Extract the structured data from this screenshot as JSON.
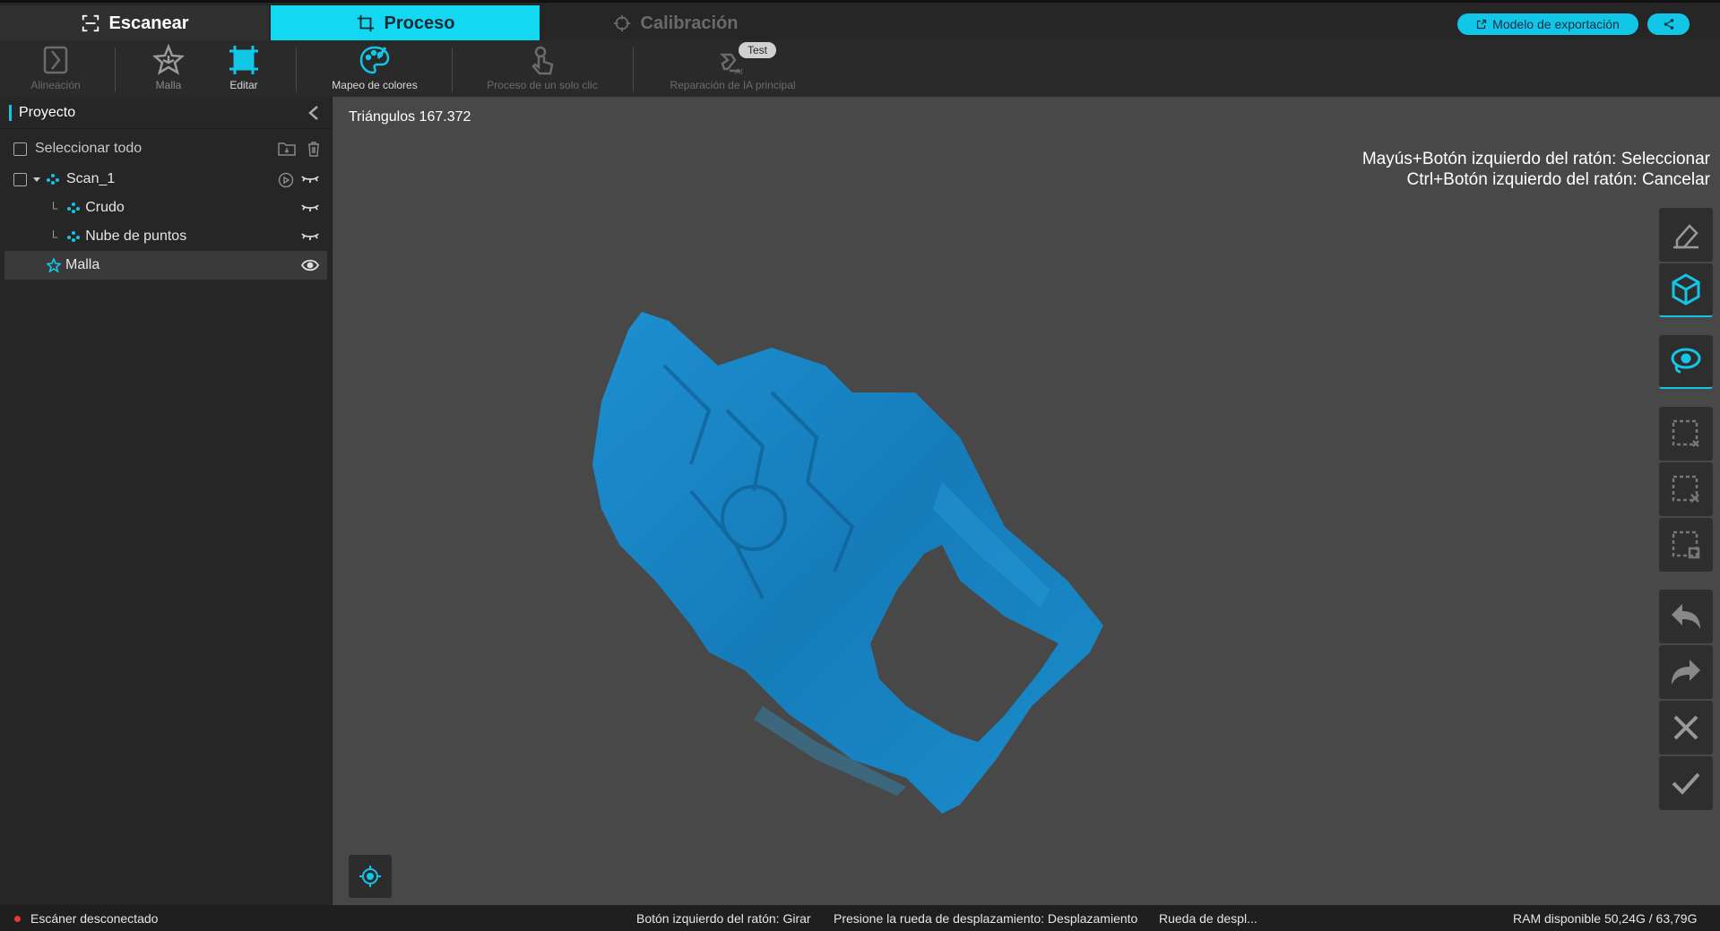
{
  "tabs": {
    "scan": "Escanear",
    "process": "Proceso",
    "calibration": "Calibración"
  },
  "header": {
    "export_label": "Modelo de exportación"
  },
  "ribbon": {
    "alignment": "Alineación",
    "mesh": "Malla",
    "edit": "Editar",
    "color_mapping": "Mapeo de colores",
    "one_click": "Proceso de un solo clic",
    "ai_repair": "Reparación de IA principal",
    "test_badge": "Test"
  },
  "panel": {
    "title": "Proyecto",
    "select_all": "Seleccionar todo",
    "items": [
      {
        "label": "Scan_1"
      },
      {
        "label": "Crudo"
      },
      {
        "label": "Nube de puntos"
      },
      {
        "label": "Malla"
      }
    ]
  },
  "viewport": {
    "triangles": "Triángulos 167.372",
    "hint_select": "Mayús+Botón izquierdo del ratón: Seleccionar",
    "hint_cancel": "Ctrl+Botón izquierdo del ratón: Cancelar"
  },
  "status": {
    "scanner": "Escáner desconectado",
    "rotate": "Botón izquierdo del ratón: Girar",
    "pan": "Presione la rueda de desplazamiento: Desplazamiento",
    "zoom": "Rueda de despl...",
    "ram": "RAM disponible 50,24G / 63,79G"
  },
  "colors": {
    "accent": "#12c6e8",
    "model": "#1a82c0",
    "disconnected": "#e53935"
  }
}
